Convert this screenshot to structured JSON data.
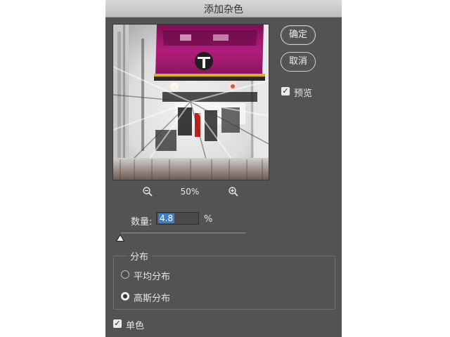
{
  "dialog": {
    "title": "添加杂色",
    "ok_label": "确定",
    "cancel_label": "取消",
    "preview_label": "预览",
    "preview_checked": true,
    "zoom_level": "50%",
    "zoom_out_icon": "zoom-out-icon",
    "zoom_in_icon": "zoom-in-icon",
    "amount": {
      "label": "数量:",
      "value": "4.8",
      "unit": "%"
    },
    "distribution": {
      "title": "分布",
      "options": [
        {
          "label": "平均分布",
          "selected": false
        },
        {
          "label": "高斯分布",
          "selected": true
        }
      ]
    },
    "monochromatic_label": "单色",
    "monochromatic_checked": true
  },
  "colors": {
    "dialog_bg": "#535353",
    "titlebar_bg": "#d0d0d0",
    "selection": "#3c7fcf",
    "train_magenta": "#a0186c",
    "train_yellow": "#d8b020"
  }
}
